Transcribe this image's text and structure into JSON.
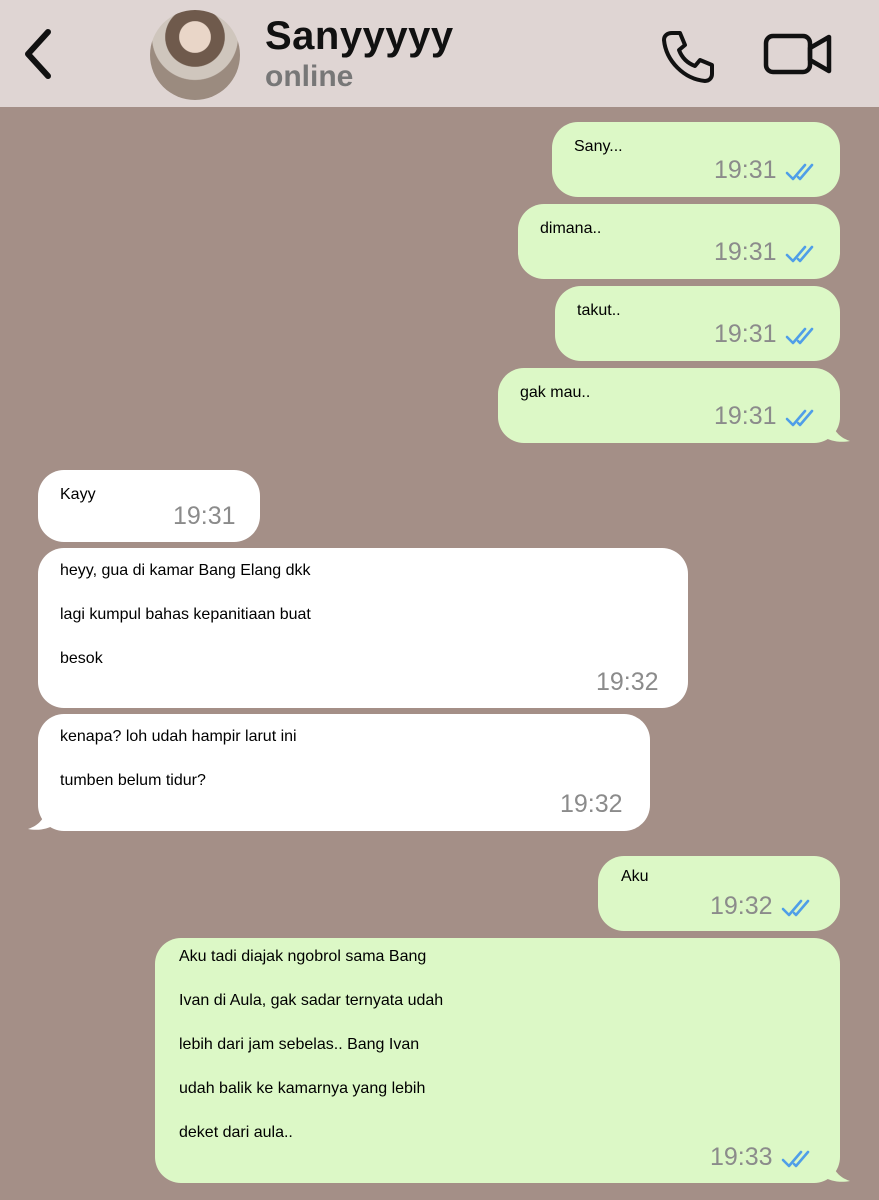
{
  "header": {
    "name": "Sanyyyyy",
    "status": "online"
  },
  "colors": {
    "chat_bg": "#a48f87",
    "header_bg": "#dfd5d3",
    "outgoing": "#dcf8c6",
    "incoming": "#ffffff",
    "tick": "#4f9ee8"
  },
  "icons": {
    "back": "chevron-left-icon",
    "call": "phone-icon",
    "video": "video-camera-icon",
    "read": "double-check-icon"
  },
  "messages": [
    {
      "dir": "out",
      "lines": [
        "Sany..."
      ],
      "time": "19:31",
      "read": true
    },
    {
      "dir": "out",
      "lines": [
        "dimana.."
      ],
      "time": "19:31",
      "read": true
    },
    {
      "dir": "out",
      "lines": [
        "takut.."
      ],
      "time": "19:31",
      "read": true
    },
    {
      "dir": "out",
      "lines": [
        "gak mau.."
      ],
      "time": "19:31",
      "read": true
    },
    {
      "dir": "in",
      "lines": [
        "Kayy"
      ],
      "time": "19:31"
    },
    {
      "dir": "in",
      "lines": [
        "heyy, gua di kamar Bang Elang dkk",
        "lagi kumpul bahas kepanitiaan buat",
        "besok"
      ],
      "time": "19:32"
    },
    {
      "dir": "in",
      "lines": [
        "kenapa? loh udah hampir larut ini",
        "tumben belum tidur?"
      ],
      "time": "19:32"
    },
    {
      "dir": "out",
      "lines": [
        "Aku"
      ],
      "time": "19:32",
      "read": true
    },
    {
      "dir": "out",
      "lines": [
        "Aku tadi diajak ngobrol sama Bang",
        "Ivan di Aula, gak sadar ternyata udah",
        "lebih dari jam sebelas.. Bang Ivan",
        "udah balik ke kamarnya yang lebih",
        "deket dari aula.."
      ],
      "time": "19:33",
      "read": true
    }
  ]
}
